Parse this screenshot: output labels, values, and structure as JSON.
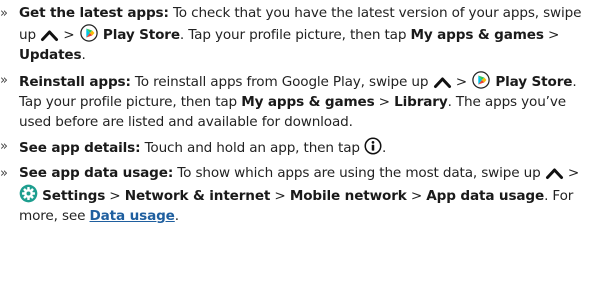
{
  "bullet_marker": "»",
  "items": [
    {
      "term": "Get the latest apps:",
      "t1": " To check that you have the latest version of your apps, swipe up ",
      "t2": " > ",
      "b1": "Play Store",
      "t3": ". Tap your profile picture, then tap ",
      "b2": "My apps & games",
      "t4": " > ",
      "b3": "Updates",
      "t5": "."
    },
    {
      "term": "Reinstall apps:",
      "t1": " To reinstall apps from Google Play, swipe up ",
      "t2": " > ",
      "b1": "Play Store",
      "t3": ". Tap your profile picture, then tap ",
      "b2": "My apps & games",
      "t4": " > ",
      "b3": "Library",
      "t5": ". The apps you’ve used before are listed and available for download."
    },
    {
      "term": "See app details:",
      "t1": " Touch and hold an app, then tap ",
      "t2": "."
    },
    {
      "term": "See app data usage:",
      "t1": " To show which apps are using the most data, swipe up ",
      "t2": " > ",
      "b1": "Settings",
      "t3": " > ",
      "b2": "Network & internet",
      "t4": " > ",
      "b3": "Mobile network",
      "t5": " > ",
      "b4": "App data usage",
      "t6": ". For more, see ",
      "link": "Data usage",
      "t7": "."
    }
  ],
  "icons": {
    "swipe_up": "chevron-up-icon",
    "play_store": "play-store-icon",
    "settings": "settings-gear-icon",
    "info": "info-icon"
  },
  "colors": {
    "text": "#222222",
    "link": "#1f5f9f",
    "settings_icon": "#1e9e8f"
  }
}
